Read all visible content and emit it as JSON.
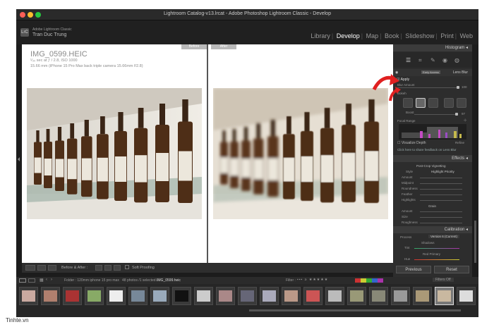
{
  "window": {
    "title": "Lightroom Catalog-v13.lrcat - Adobe Photoshop Lightroom Classic - Develop"
  },
  "identity": {
    "line1": "Adobe Lightroom Classic",
    "line2": "Tran Duc Trung",
    "logo": "LrC"
  },
  "modules": [
    "Library",
    "Develop",
    "Map",
    "Book",
    "Slideshow",
    "Print",
    "Web"
  ],
  "active_module": "Develop",
  "view": {
    "before_label": "Before",
    "after_label": "After"
  },
  "photo_info": {
    "filename": "IMG_0599.HEIC",
    "exposure": "¹⁄₃₀ sec at ƒ / 2.8, ISO 1000",
    "lens": "15.66 mm (iPhone 15 Pro Max back triple camera 15.66mm f/2.8)"
  },
  "toolbar": {
    "before_after": "Before & After :",
    "soft_proofing": "Soft Proofing"
  },
  "panels": {
    "histogram": "Histogram",
    "lens_blur": "Lens Blur",
    "early_access": "Early Access",
    "apply": "Apply",
    "blur_amount_label": "Blur Amount",
    "blur_amount_value": "100",
    "bokeh_label": "Bokeh",
    "boost_label": "Boost",
    "boost_value": "97",
    "focal_range": "Focal Range",
    "visualize_depth": "Visualize Depth",
    "refine": "Refine",
    "feedback": "Click here to share feedback on Lens Blur",
    "effects": "Effects",
    "vignetting": "Post-Crop Vignetting",
    "style_label": "Style",
    "style_value": "Highlight Priority",
    "amount": "Amount",
    "midpoint": "Midpoint",
    "roundness": "Roundness",
    "feather": "Feather",
    "highlights": "Highlights",
    "grain": "Grain",
    "size": "Size",
    "roughness": "Roughness",
    "calibration": "Calibration",
    "process_label": "Process",
    "process_value": "Version 6 (Current)",
    "shadows": "Shadows",
    "tint": "Tint",
    "red_primary": "Red Primary",
    "hue": "Hue",
    "previous": "Previous",
    "reset": "Reset"
  },
  "filmstrip": {
    "folder": "Folder : 120mm iphone 15 pro max",
    "count": "48 photos /1 selected /",
    "selected": "IMG_0599.heic",
    "filter_label": "Filter :",
    "filters_off": "Filters Off"
  },
  "credit": "Tinhte.vn"
}
